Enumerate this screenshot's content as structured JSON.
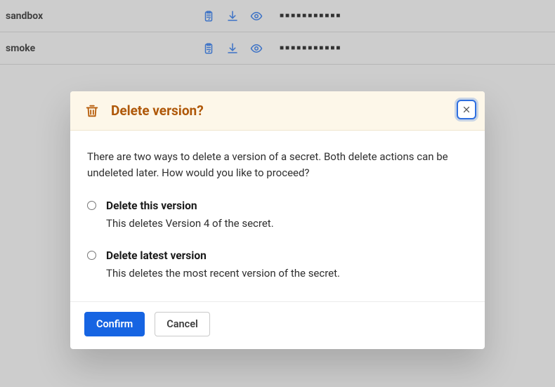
{
  "secrets": {
    "rows": [
      {
        "name": "sandbox",
        "masked": "■■■■■■■■■■■"
      },
      {
        "name": "smoke",
        "masked": "■■■■■■■■■■■"
      }
    ]
  },
  "modal": {
    "title": "Delete version?",
    "intro": "There are two ways to delete a version of a secret. Both delete actions can be undeleted later. How would you like to proceed?",
    "options": [
      {
        "title": "Delete this version",
        "description": "This deletes Version 4 of the secret."
      },
      {
        "title": "Delete latest version",
        "description": "This deletes the most recent version of the secret."
      }
    ],
    "buttons": {
      "confirm": "Confirm",
      "cancel": "Cancel"
    }
  }
}
